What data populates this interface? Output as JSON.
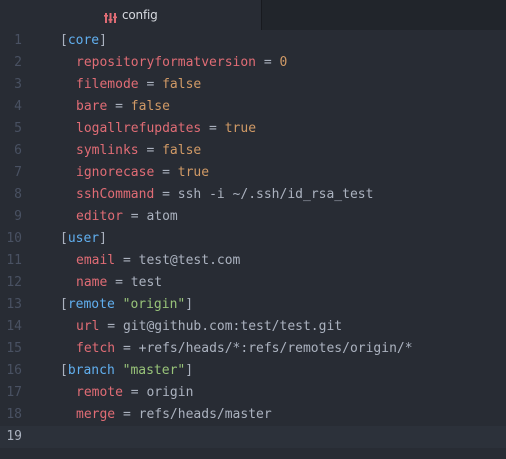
{
  "tab": {
    "title": "config",
    "icon": "git-config-icon"
  },
  "colors": {
    "section": "#61afef",
    "key": "#e06c75",
    "string": "#98c379",
    "constant": "#d19a66",
    "text": "#abb2bf",
    "line_number": "#495162",
    "background": "#282c34"
  },
  "lines": [
    {
      "num": "1",
      "section": "core"
    },
    {
      "num": "2",
      "key": "repositoryformatversion",
      "value": "0",
      "vtype": "num"
    },
    {
      "num": "3",
      "key": "filemode",
      "value": "false",
      "vtype": "bool"
    },
    {
      "num": "4",
      "key": "bare",
      "value": "false",
      "vtype": "bool"
    },
    {
      "num": "5",
      "key": "logallrefupdates",
      "value": "true",
      "vtype": "bool"
    },
    {
      "num": "6",
      "key": "symlinks",
      "value": "false",
      "vtype": "bool"
    },
    {
      "num": "7",
      "key": "ignorecase",
      "value": "true",
      "vtype": "bool"
    },
    {
      "num": "8",
      "key": "sshCommand",
      "value": "ssh -i ~/.ssh/id_rsa_test",
      "vtype": "val"
    },
    {
      "num": "9",
      "key": "editor",
      "value": "atom",
      "vtype": "val"
    },
    {
      "num": "10",
      "section": "user"
    },
    {
      "num": "11",
      "key": "email",
      "value": "test@test.com",
      "vtype": "val"
    },
    {
      "num": "12",
      "key": "name",
      "value": "test",
      "vtype": "val"
    },
    {
      "num": "13",
      "section": "remote",
      "subsection": "\"origin\""
    },
    {
      "num": "14",
      "key": "url",
      "value": "git@github.com:test/test.git",
      "vtype": "val"
    },
    {
      "num": "15",
      "key": "fetch",
      "value": "+refs/heads/*:refs/remotes/origin/*",
      "vtype": "val"
    },
    {
      "num": "16",
      "section": "branch",
      "subsection": "\"master\""
    },
    {
      "num": "17",
      "key": "remote",
      "value": "origin",
      "vtype": "val"
    },
    {
      "num": "18",
      "key": "merge",
      "value": "refs/heads/master",
      "vtype": "val"
    },
    {
      "num": "19",
      "empty": true,
      "cursor": true
    }
  ]
}
